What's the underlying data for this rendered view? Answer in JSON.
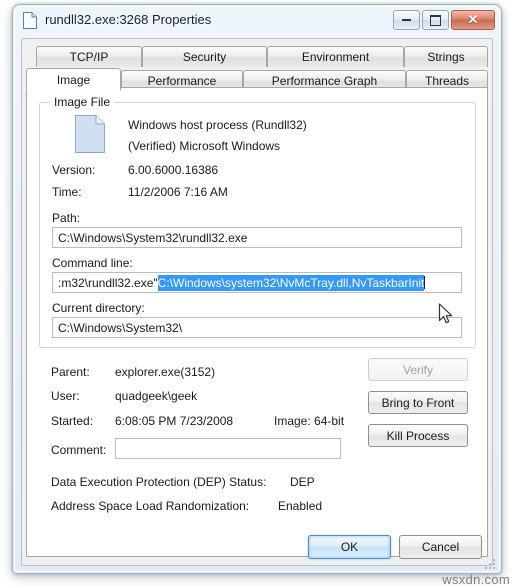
{
  "window": {
    "title": "rundll32.exe:3268 Properties",
    "title_icon": "document-icon",
    "minimize_label": "Minimize",
    "maximize_label": "Maximize",
    "close_label": "✕"
  },
  "tabs": {
    "row1": [
      {
        "label": "TCP/IP",
        "selected": false
      },
      {
        "label": "Security",
        "selected": false
      },
      {
        "label": "Environment",
        "selected": false
      },
      {
        "label": "Strings",
        "selected": false
      }
    ],
    "row2": [
      {
        "label": "Image",
        "selected": true
      },
      {
        "label": "Performance",
        "selected": false
      },
      {
        "label": "Performance Graph",
        "selected": false
      },
      {
        "label": "Threads",
        "selected": false
      }
    ]
  },
  "image_file": {
    "group_title": "Image File",
    "description": "Windows host process (Rundll32)",
    "publisher": "(Verified) Microsoft Windows",
    "version_label": "Version:",
    "version_value": "6.00.6000.16386",
    "time_label": "Time:",
    "time_value": "11/2/2006 7:16 AM",
    "path_label": "Path:",
    "path_value": "C:\\Windows\\System32\\rundll32.exe",
    "cmdline_label": "Command line:",
    "cmdline_prefix": ":m32\\rundll32.exe\"",
    "cmdline_selected": "C:\\Windows\\system32\\NvMcTray.dll,NvTaskbarInit",
    "curdir_label": "Current directory:",
    "curdir_value": "C:\\Windows\\System32\\"
  },
  "process_info": {
    "parent_label": "Parent:",
    "parent_value": "explorer.exe(3152)",
    "user_label": "User:",
    "user_value": "quadgeek\\geek",
    "started_label": "Started:",
    "started_value": "6:08:05 PM  7/23/2008",
    "image_bits_label": "Image: 64-bit",
    "comment_label": "Comment:",
    "comment_value": "",
    "dep_label": "Data Execution Protection (DEP) Status:",
    "dep_value": "DEP",
    "aslr_label": "Address Space Load Randomization:",
    "aslr_value": "Enabled"
  },
  "buttons": {
    "verify": "Verify",
    "bring_to_front": "Bring to Front",
    "kill_process": "Kill Process",
    "ok": "OK",
    "cancel": "Cancel"
  },
  "colors": {
    "selection_blue": "#3399ff",
    "close_red": "#d9826c",
    "default_button_blue": "#4e8ec2"
  },
  "watermark": "wsxdn.com"
}
